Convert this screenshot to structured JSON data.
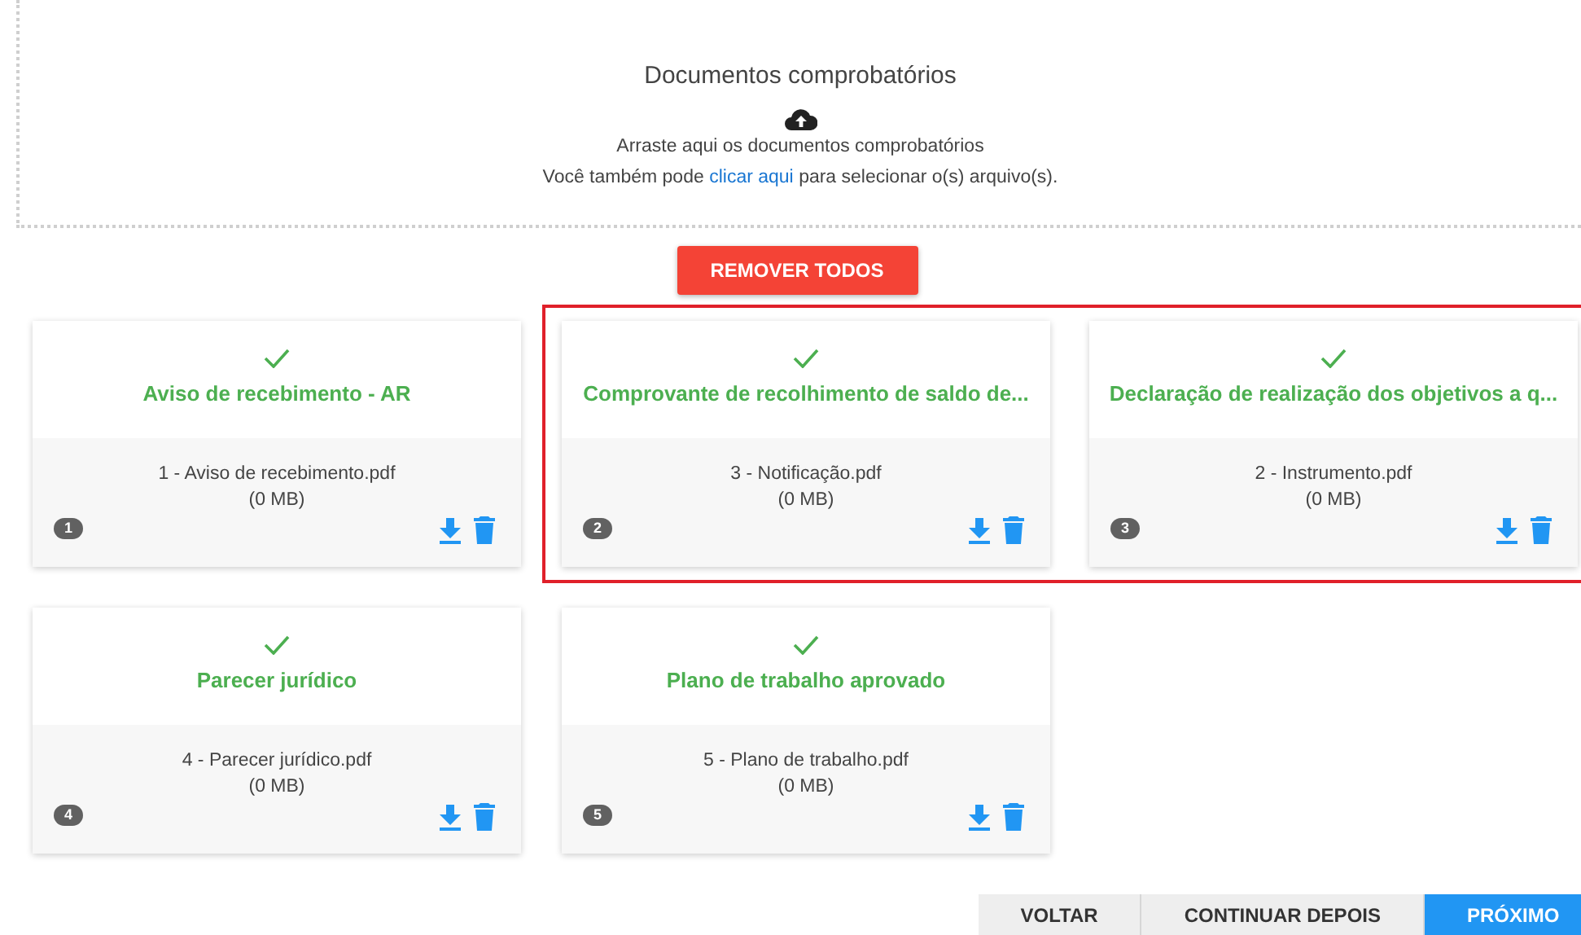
{
  "dropzone": {
    "title": "Documentos comprobatórios",
    "hint": "Arraste aqui os documentos comprobatórios",
    "select_before": "Você também pode",
    "select_link": "clicar aqui",
    "select_after": "para selecionar o(s) arquivo(s)."
  },
  "remove_all": "REMOVER TODOS",
  "cards": [
    {
      "title": "Aviso de recebimento - AR",
      "file": "1 - Aviso de recebimento.pdf",
      "size": "(0 MB)",
      "number": "1",
      "done": true,
      "highlighted": false
    },
    {
      "title": "Comprovante de recolhimento de saldo de...",
      "file": "3 - Notificação.pdf",
      "size": "(0 MB)",
      "number": "2",
      "done": true,
      "highlighted": true
    },
    {
      "title": "Declaração de realização dos objetivos a q...",
      "file": "2 - Instrumento.pdf",
      "size": "(0 MB)",
      "number": "3",
      "done": true,
      "highlighted": true
    },
    {
      "title": "Parecer jurídico",
      "file": "4 - Parecer jurídico.pdf",
      "size": "(0 MB)",
      "number": "4",
      "done": true,
      "highlighted": false
    },
    {
      "title": "Plano de trabalho aprovado",
      "file": "5 - Plano de trabalho.pdf",
      "size": "(0 MB)",
      "number": "5",
      "done": true,
      "highlighted": false
    }
  ],
  "footer_buttons": [
    {
      "label": "VOLTAR",
      "kind": "secondary"
    },
    {
      "label": "CONTINUAR DEPOIS",
      "kind": "secondary"
    },
    {
      "label": "PRÓXIMO",
      "kind": "primary"
    }
  ]
}
